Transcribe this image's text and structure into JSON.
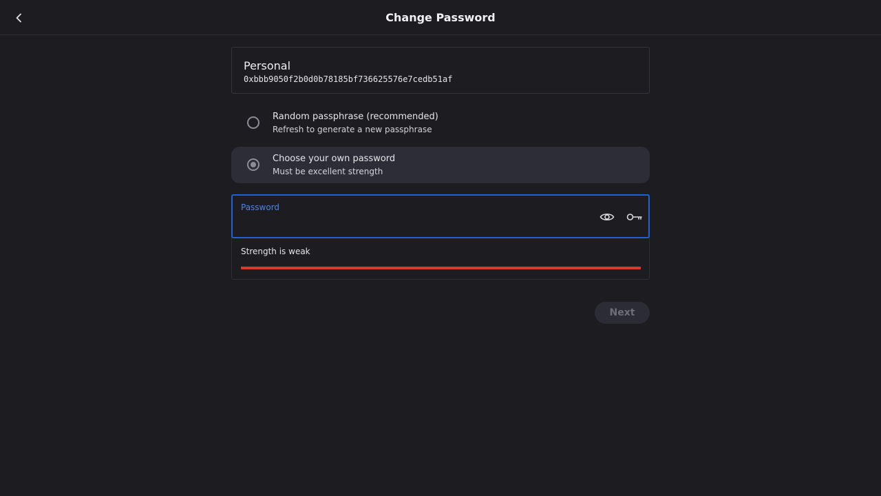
{
  "header": {
    "title": "Change Password",
    "back_icon": "chevron-left-icon"
  },
  "account": {
    "name": "Personal",
    "address": "0xbbb9050f2b0d0b78185bf736625576e7cedb51af"
  },
  "options": [
    {
      "title": "Random passphrase (recommended)",
      "subtitle": "Refresh to generate a new passphrase",
      "selected": false
    },
    {
      "title": "Choose your own password",
      "subtitle": "Must be excellent strength",
      "selected": true
    }
  ],
  "password_field": {
    "label": "Password",
    "value": "",
    "show_icon": "eye-icon",
    "generate_icon": "key-icon"
  },
  "strength": {
    "text": "Strength is weak",
    "level_fraction": 1.0,
    "color": "#d9372b"
  },
  "next_button": {
    "label": "Next",
    "enabled": false
  },
  "colors": {
    "background": "#1c1c21",
    "accent": "#1f62d3",
    "selected_option": "#2c2d35"
  }
}
